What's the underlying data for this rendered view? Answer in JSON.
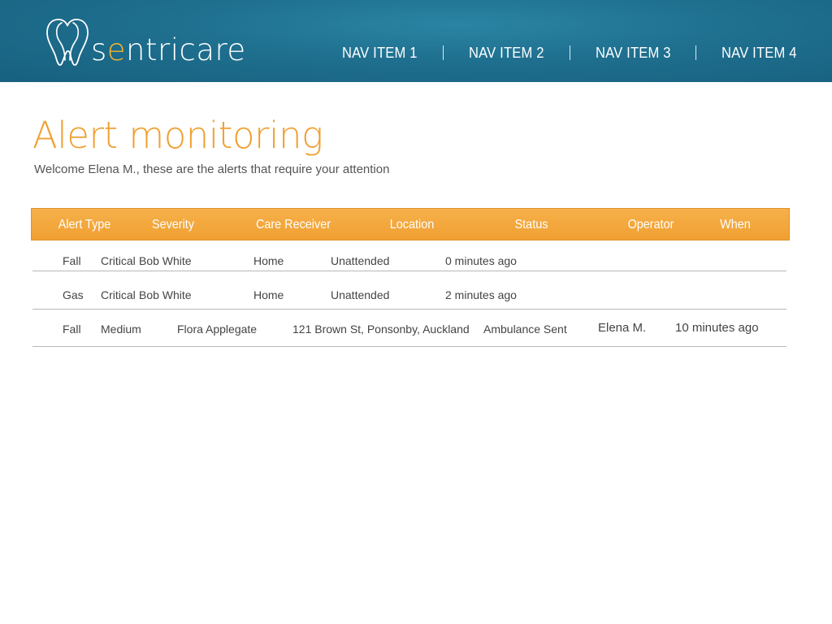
{
  "brand": {
    "name_prefix": "s",
    "name_accent": "e",
    "name_suffix": "ntricare",
    "logo_icon": "tooth-icon",
    "accent_color": "#f2b331"
  },
  "nav": {
    "items": [
      {
        "label": "NAV ITEM 1"
      },
      {
        "label": "NAV ITEM 2"
      },
      {
        "label": "NAV ITEM 3"
      },
      {
        "label": "NAV ITEM 4"
      }
    ]
  },
  "page": {
    "title": "Alert monitoring",
    "subtitle": "Welcome Elena M., these are the alerts that require your attention",
    "title_color": "#f0a032",
    "header_color": "#1f6f8f"
  },
  "table": {
    "headers": [
      "Alert Type",
      "Severity",
      "Care Receiver",
      "Location",
      "Status",
      "Operator",
      "When"
    ],
    "rows": [
      {
        "alert_type": "Fall",
        "severity": "Critical",
        "care_receiver": "Bob White",
        "location": "Home",
        "status": "Unattended",
        "operator": "",
        "when": "0 minutes ago"
      },
      {
        "alert_type": "Gas",
        "severity": "Critical",
        "care_receiver": "Bob White",
        "location": "Home",
        "status": "Unattended",
        "operator": "",
        "when": "2 minutes ago"
      },
      {
        "alert_type": "Fall",
        "severity": "Medium",
        "care_receiver": "Flora Applegate",
        "location": "121 Brown St, Ponsonby, Auckland",
        "status": "Ambulance Sent",
        "operator": "Elena M.",
        "when": "10 minutes ago"
      }
    ]
  }
}
